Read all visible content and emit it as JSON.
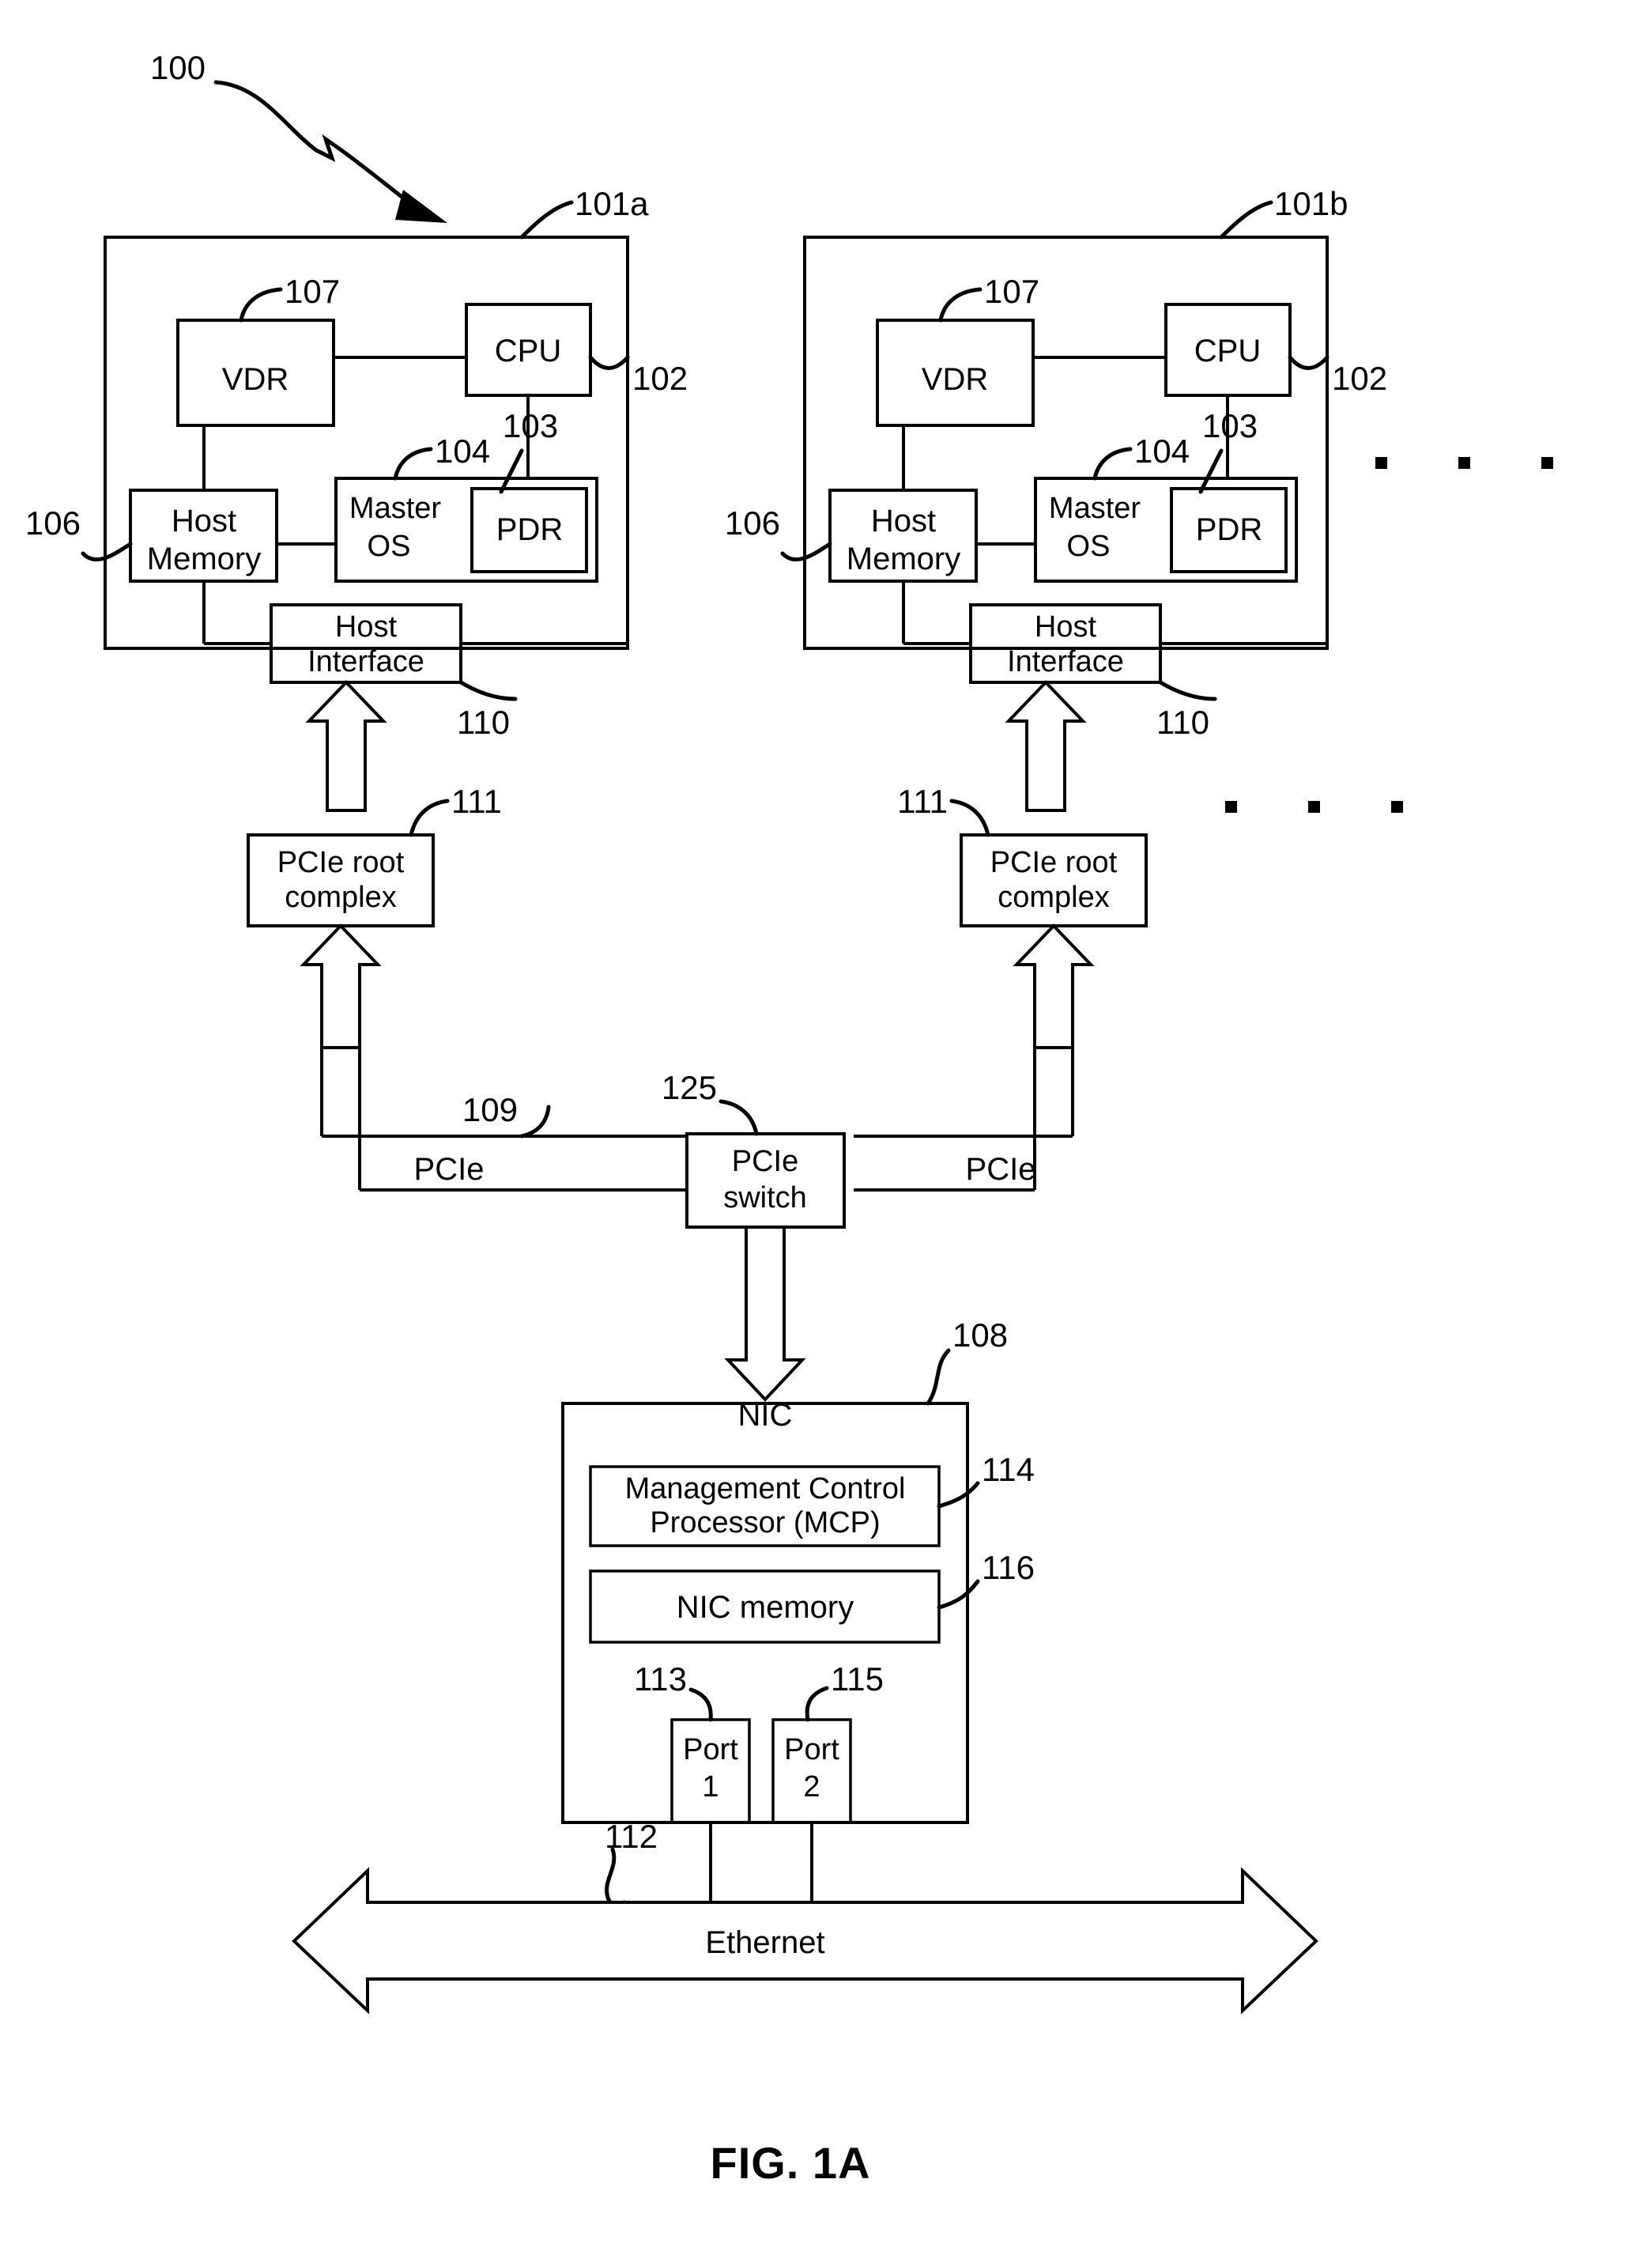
{
  "figure": {
    "caption": "FIG. 1A",
    "system_ref": "100"
  },
  "hosts": [
    {
      "ref": "101a",
      "host_box_ref": "102",
      "vdr": {
        "label": "VDR",
        "ref": "107"
      },
      "cpu": {
        "label": "CPU"
      },
      "host_memory": {
        "label_line1": "Host",
        "label_line2": "Memory",
        "ref": "106"
      },
      "master_os": {
        "label_line1": "Master",
        "label_line2": "OS",
        "ref": "104"
      },
      "pdr": {
        "label": "PDR",
        "ref": "103"
      },
      "host_interface": {
        "label_line1": "Host",
        "label_line2": "Interface",
        "ref": "110"
      },
      "pcie_root_complex": {
        "label_line1": "PCIe root",
        "label_line2": "complex",
        "ref": "111"
      },
      "bus_label": "PCIe"
    },
    {
      "ref": "101b",
      "host_box_ref": "102",
      "vdr": {
        "label": "VDR",
        "ref": "107"
      },
      "cpu": {
        "label": "CPU"
      },
      "host_memory": {
        "label_line1": "Host",
        "label_line2": "Memory",
        "ref": "106"
      },
      "master_os": {
        "label_line1": "Master",
        "label_line2": "OS",
        "ref": "104"
      },
      "pdr": {
        "label": "PDR",
        "ref": "103"
      },
      "host_interface": {
        "label_line1": "Host",
        "label_line2": "Interface",
        "ref": "110"
      },
      "pcie_root_complex": {
        "label_line1": "PCIe root",
        "label_line2": "complex",
        "ref": "111"
      },
      "bus_label": "PCIe"
    }
  ],
  "pcie_switch": {
    "label_line1": "PCIe",
    "label_line2": "switch",
    "ref": "125",
    "bus_ref": "109"
  },
  "nic": {
    "label": "NIC",
    "ref": "108",
    "mcp": {
      "label_line1": "Management Control",
      "label_line2": "Processor (MCP)",
      "ref": "114"
    },
    "nic_memory": {
      "label": "NIC memory",
      "ref": "116"
    },
    "port1": {
      "label_line1": "Port",
      "label_line2": "1",
      "ref": "113"
    },
    "port2": {
      "label_line1": "Port",
      "label_line2": "2",
      "ref": "115"
    }
  },
  "ethernet": {
    "label": "Ethernet",
    "ref": "112"
  },
  "ellipsis": {
    "glyph": "▪"
  },
  "colors": {
    "stroke": "#000000",
    "fill": "#ffffff"
  }
}
